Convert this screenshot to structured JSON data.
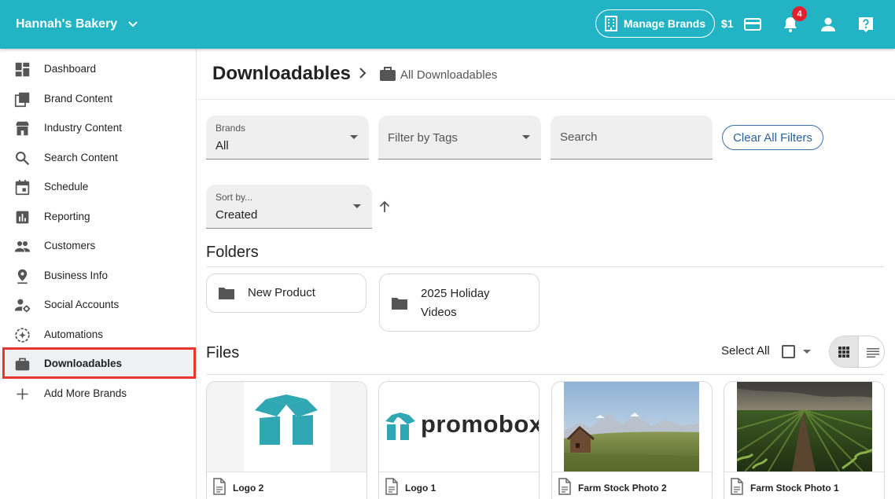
{
  "header": {
    "account_name": "Hannah's Bakery",
    "manage_brands_label": "Manage Brands",
    "credit": "$1",
    "notification_count": "4"
  },
  "sidebar": {
    "items": [
      {
        "label": "Dashboard",
        "icon": "dashboard-icon"
      },
      {
        "label": "Brand Content",
        "icon": "brand-content-icon"
      },
      {
        "label": "Industry Content",
        "icon": "store-icon"
      },
      {
        "label": "Search Content",
        "icon": "search-icon"
      },
      {
        "label": "Schedule",
        "icon": "calendar-icon"
      },
      {
        "label": "Reporting",
        "icon": "bar-chart-icon"
      },
      {
        "label": "Customers",
        "icon": "people-icon"
      },
      {
        "label": "Business Info",
        "icon": "location-pin-icon"
      },
      {
        "label": "Social Accounts",
        "icon": "person-gear-icon"
      },
      {
        "label": "Automations",
        "icon": "automation-icon"
      },
      {
        "label": "Downloadables",
        "icon": "briefcase-icon",
        "active": true
      },
      {
        "label": "Add More Brands",
        "icon": "plus-icon"
      }
    ]
  },
  "page": {
    "title": "Downloadables",
    "breadcrumb": "All Downloadables"
  },
  "filters": {
    "brands_label": "Brands",
    "brands_value": "All",
    "tags_placeholder": "Filter by Tags",
    "search_placeholder": "Search",
    "clear_label": "Clear All Filters",
    "sort_label": "Sort by...",
    "sort_value": "Created"
  },
  "folders": {
    "title": "Folders",
    "items": [
      {
        "name": "New Product"
      },
      {
        "name": "2025 Holiday Videos",
        "line1": "2025 Holiday",
        "line2": "Videos"
      }
    ]
  },
  "files": {
    "title": "Files",
    "select_all_label": "Select All",
    "items": [
      {
        "name": "Logo 2"
      },
      {
        "name": "Logo 1",
        "logo_text": "promoboxx",
        "logo_mark": "®"
      },
      {
        "name": "Farm Stock Photo 2"
      },
      {
        "name": "Farm Stock Photo 1"
      }
    ]
  },
  "colors": {
    "brand": "#22b3c4",
    "logo_teal": "#2fa8b3",
    "highlight": "#e8362d",
    "badge": "#e5202e",
    "link": "#2a5f9e"
  }
}
